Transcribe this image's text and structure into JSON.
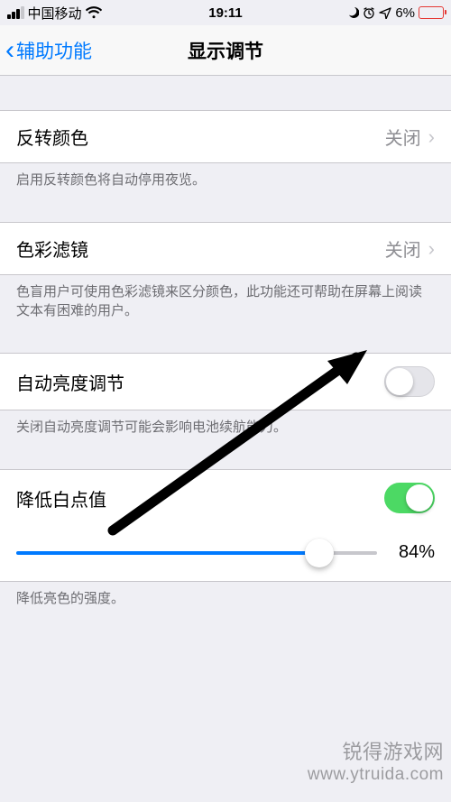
{
  "status": {
    "carrier": "中国移动",
    "time": "19:11",
    "battery_pct": "6%"
  },
  "nav": {
    "back_label": "辅助功能",
    "title": "显示调节"
  },
  "rows": {
    "invert": {
      "label": "反转颜色",
      "value": "关闭"
    },
    "invert_footer": "启用反转颜色将自动停用夜览。",
    "color_filter": {
      "label": "色彩滤镜",
      "value": "关闭"
    },
    "color_filter_footer": "色盲用户可使用色彩滤镜来区分颜色，此功能还可帮助在屏幕上阅读文本有困难的用户。",
    "auto_brightness": {
      "label": "自动亮度调节"
    },
    "auto_brightness_footer": "关闭自动亮度调节可能会影响电池续航能力。",
    "white_point": {
      "label": "降低白点值"
    },
    "slider_value": "84%",
    "white_point_footer": "降低亮色的强度。"
  },
  "watermark": {
    "zh": "锐得游戏网",
    "url": "www.ytruida.com"
  }
}
